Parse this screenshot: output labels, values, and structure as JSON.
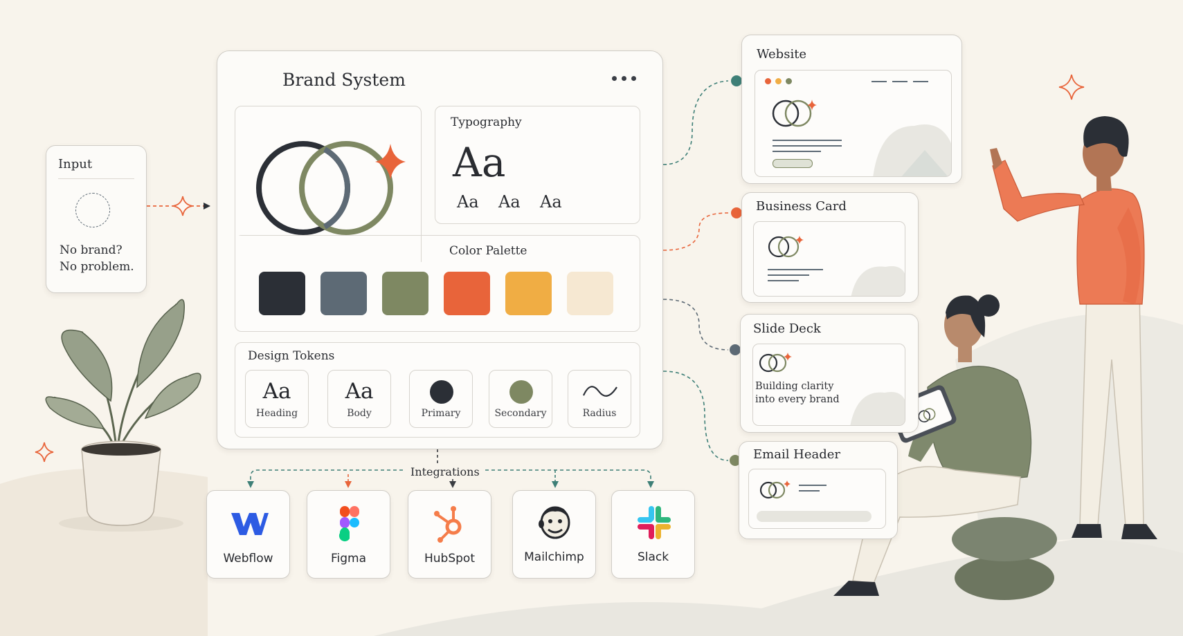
{
  "input": {
    "title": "Input",
    "line1": "No brand?",
    "line2": "No problem."
  },
  "brand_system": {
    "title": "Brand System",
    "typography": {
      "label": "Typography",
      "big": "Aa",
      "small": [
        "Aa",
        "Aa",
        "Aa"
      ]
    },
    "color_palette": {
      "label": "Color Palette",
      "colors": [
        "#2b2f36",
        "#5d6a75",
        "#7e8862",
        "#e8643a",
        "#f0ad44",
        "#f6e8d2"
      ]
    },
    "design_tokens": {
      "label": "Design Tokens",
      "heading_glyph": "Aa",
      "heading": "Heading",
      "body_glyph": "Aa",
      "body": "Body",
      "primary": "Primary",
      "secondary": "Secondary",
      "radius": "Radius"
    }
  },
  "integrations": {
    "label": "Integrations",
    "items": [
      "Webflow",
      "Figma",
      "HubSpot",
      "Mailchimp",
      "Slack"
    ]
  },
  "outputs": {
    "website": "Website",
    "business_card": "Business Card",
    "slide_deck": {
      "title": "Slide Deck",
      "line1": "Building clarity",
      "line2": "into every brand"
    },
    "email_header": "Email Header"
  },
  "colors": {
    "accent": "#e8643a",
    "dark": "#2b2f36",
    "slate": "#5d6a75",
    "olive": "#7e8862",
    "teal": "#3e7f77"
  }
}
